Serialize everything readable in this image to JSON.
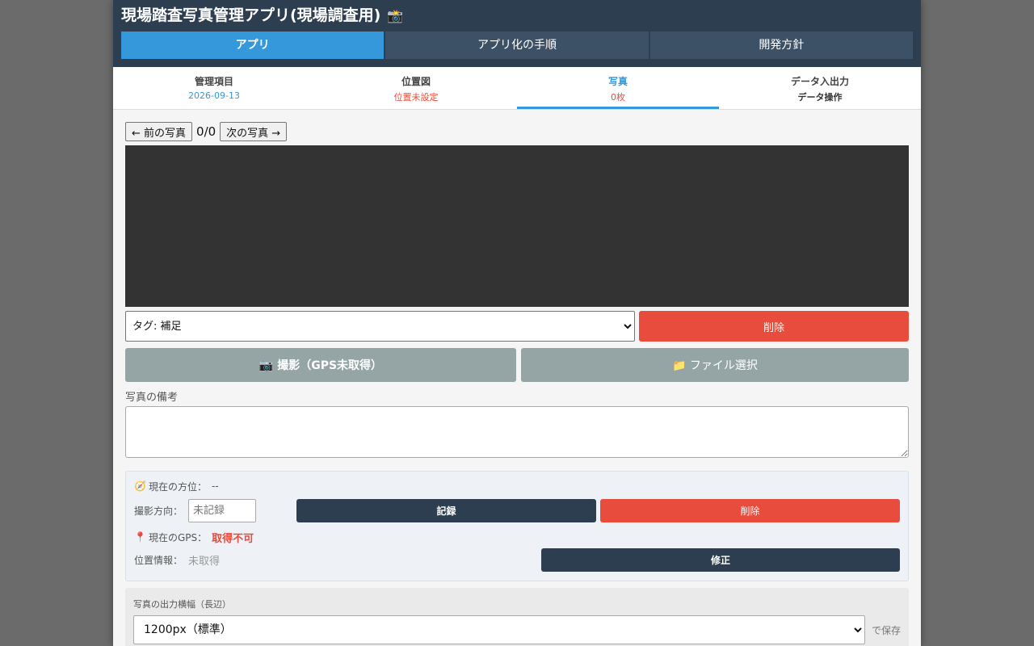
{
  "header": {
    "title": "現場踏査写真管理アプリ(現場調査用)",
    "title_icon": "📸"
  },
  "main_tabs": [
    {
      "label": "アプリ",
      "active": true
    },
    {
      "label": "アプリ化の手順",
      "active": false
    },
    {
      "label": "開発方針",
      "active": false
    }
  ],
  "sub_tabs": [
    {
      "label": "管理項目",
      "sub": "2026-09-13"
    },
    {
      "label": "位置図",
      "sub": "位置未設定"
    },
    {
      "label": "写真",
      "sub": "0枚"
    },
    {
      "label": "データ入出力",
      "sub": "データ操作"
    }
  ],
  "photo_nav": {
    "prev_label": "← 前の写真",
    "counter": "0/0",
    "next_label": "次の写真 →"
  },
  "tag_select": {
    "value": "タグ: 補足"
  },
  "buttons": {
    "delete_photo": "削除",
    "capture": "📷 撮影（GPS未取得）",
    "file_select": "📁 ファイル選択"
  },
  "memo": {
    "label": "写真の備考",
    "value": ""
  },
  "direction_panel": {
    "compass_icon": "🧭",
    "current_direction_label": "現在の方位：",
    "current_direction_value": "--",
    "shoot_direction_label": "撮影方向：",
    "shoot_direction_placeholder": "未記録",
    "record_button": "記録",
    "delete_button": "削除",
    "pin_icon": "📍",
    "gps_label": "現在のGPS：",
    "gps_value": "取得不可",
    "location_label": "位置情報：",
    "location_value": "未取得",
    "fix_button": "修正"
  },
  "output": {
    "label": "写真の出力横幅（長辺）",
    "selected": "1200px（標準）",
    "suffix": "で保存"
  }
}
